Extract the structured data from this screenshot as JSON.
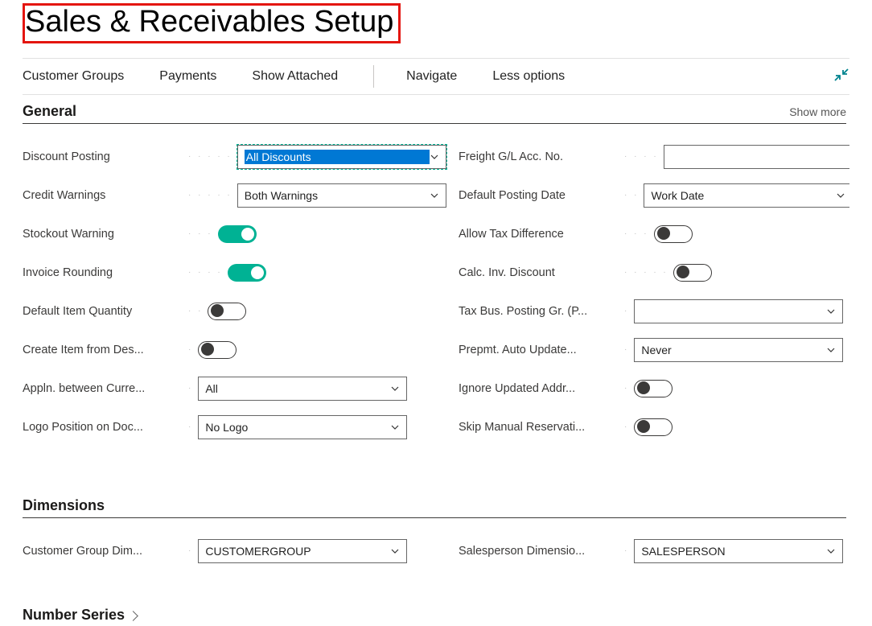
{
  "page_title": "Sales & Receivables Setup",
  "toolbar": {
    "customer_groups": "Customer Groups",
    "payments": "Payments",
    "show_attached": "Show Attached",
    "navigate": "Navigate",
    "less_options": "Less options"
  },
  "sections": {
    "general": {
      "title": "General",
      "show_more": "Show more",
      "left": {
        "discount_posting": {
          "label": "Discount Posting",
          "value": "All Discounts"
        },
        "credit_warnings": {
          "label": "Credit Warnings",
          "value": "Both Warnings"
        },
        "stockout_warning": {
          "label": "Stockout Warning",
          "on": true
        },
        "invoice_rounding": {
          "label": "Invoice Rounding",
          "on": true
        },
        "default_item_quantity": {
          "label": "Default Item Quantity",
          "on": false
        },
        "create_item_from_desc": {
          "label": "Create Item from Des...",
          "on": false
        },
        "appln_between_curr": {
          "label": "Appln. between Curre...",
          "value": "All"
        },
        "logo_position": {
          "label": "Logo Position on Doc...",
          "value": "No Logo"
        }
      },
      "right": {
        "freight_gl": {
          "label": "Freight G/L Acc. No.",
          "value": ""
        },
        "default_posting_date": {
          "label": "Default Posting Date",
          "value": "Work Date"
        },
        "allow_tax_diff": {
          "label": "Allow Tax Difference",
          "on": false
        },
        "calc_inv_discount": {
          "label": "Calc. Inv. Discount",
          "on": false
        },
        "tax_bus_posting_gr": {
          "label": "Tax Bus. Posting Gr. (P...",
          "value": ""
        },
        "prepmt_auto_update": {
          "label": "Prepmt. Auto Update...",
          "value": "Never"
        },
        "ignore_updated_addr": {
          "label": "Ignore Updated Addr...",
          "on": false
        },
        "skip_manual_reserv": {
          "label": "Skip Manual Reservati...",
          "on": false
        }
      }
    },
    "dimensions": {
      "title": "Dimensions",
      "customer_group_dim": {
        "label": "Customer Group Dim...",
        "value": "CUSTOMERGROUP"
      },
      "salesperson_dim": {
        "label": "Salesperson Dimensio...",
        "value": "SALESPERSON"
      }
    },
    "number_series": {
      "title": "Number Series"
    }
  }
}
